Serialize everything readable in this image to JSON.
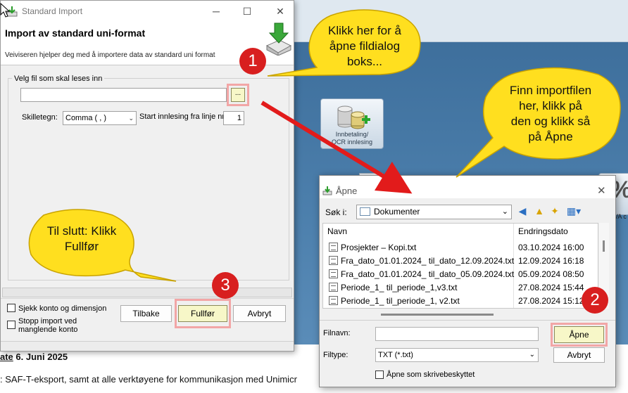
{
  "import_window": {
    "title": "Standard Import",
    "heading": "Import av standard uni-format",
    "subtitle": "Veiviseren hjelper deg med å importere data av standard uni format",
    "group_label": "Velg fil som skal leses inn",
    "file_path": "",
    "browse_label": "...",
    "separator_label": "Skilletegn:",
    "separator_value": "Comma ( , )",
    "start_line_label": "Start innlesing fra linje nr:",
    "start_line_value": "1",
    "check_account_label": "Sjekk konto og dimensjon",
    "stop_import_label": "Stopp import ved manglende konto",
    "back_label": "Tilbake",
    "finish_label": "Fullfør",
    "cancel_label": "Avbryt"
  },
  "open_dialog": {
    "title": "Åpne",
    "look_in_label": "Søk i:",
    "look_in_value": "Dokumenter",
    "col_name": "Navn",
    "col_date": "Endringsdato",
    "files": [
      {
        "name": "Prosjekter – Kopi.txt",
        "date": "03.10.2024 16:00"
      },
      {
        "name": "Fra_dato_01.01.2024_ til_dato_12.09.2024.txt",
        "date": "12.09.2024 16:18"
      },
      {
        "name": "Fra_dato_01.01.2024_ til_dato_05.09.2024.txt",
        "date": "05.09.2024 08:50"
      },
      {
        "name": "Periode_1_ til_periode_1,v3.txt",
        "date": "27.08.2024 15:44"
      },
      {
        "name": "Periode_1_ til_periode_1, v2.txt",
        "date": "27.08.2024 15:12"
      }
    ],
    "filename_label": "Filnavn:",
    "filename_value": "",
    "filetype_label": "Filtype:",
    "filetype_value": "TXT (*.txt)",
    "open_label": "Åpne",
    "cancel_label": "Avbryt",
    "readonly_label": "Åpne som skrivebeskyttet"
  },
  "background": {
    "tile_label_line1": "Innbetaling/",
    "tile_label_line2": "OCR innlesing",
    "tile2_glyph": "%",
    "tile2_label": "VA c",
    "date_prefix": "ate",
    "date_value": "6. Juni 2025",
    "body_line": ": SAF-T-eksport, samt at alle verktøyene for kommunikasjon med Unimicr"
  },
  "callouts": {
    "step1_line1": "Klikk her for å",
    "step1_line2": "åpne fildialog",
    "step1_line3": "boks...",
    "step2_line1": "Finn importfilen",
    "step2_line2": "her, klikk på",
    "step2_line3": "den og klikk så",
    "step2_line4": "på Åpne",
    "step3_line1": "Til slutt: Klikk",
    "step3_line2": "Fullfør",
    "badge1": "1",
    "badge2": "2",
    "badge3": "3"
  },
  "colors": {
    "callout_fill": "#ffdf1f",
    "callout_stroke": "#c9a300",
    "badge_red": "#d81f1f",
    "highlight_pink": "#f2a6a6",
    "arrow_red": "#e21b1b"
  }
}
